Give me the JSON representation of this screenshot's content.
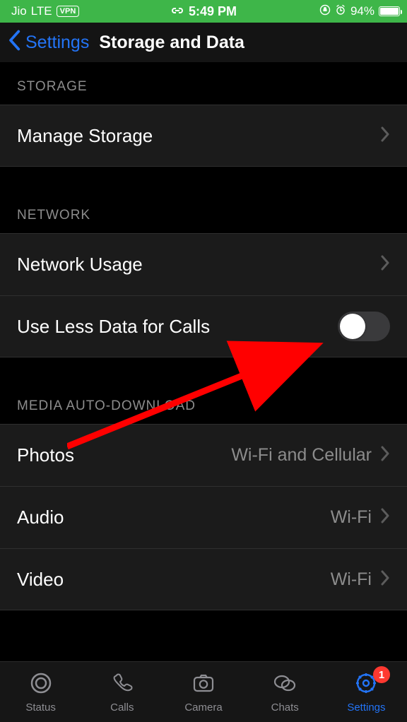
{
  "statusbar": {
    "carrier": "Jio",
    "network": "LTE",
    "vpn": "VPN",
    "time": "5:49 PM",
    "battery_pct": "94%"
  },
  "nav": {
    "back": "Settings",
    "title": "Storage and Data"
  },
  "sections": {
    "storage_header": "STORAGE",
    "network_header": "NETWORK",
    "media_header": "MEDIA AUTO-DOWNLOAD"
  },
  "rows": {
    "manage_storage": "Manage Storage",
    "network_usage": "Network Usage",
    "use_less_data": "Use Less Data for Calls",
    "photos": {
      "label": "Photos",
      "value": "Wi-Fi and Cellular"
    },
    "audio": {
      "label": "Audio",
      "value": "Wi-Fi"
    },
    "video": {
      "label": "Video",
      "value": "Wi-Fi"
    }
  },
  "use_less_data_on": false,
  "tabs": {
    "status": "Status",
    "calls": "Calls",
    "camera": "Camera",
    "chats": "Chats",
    "settings": "Settings"
  },
  "badge_count": "1"
}
